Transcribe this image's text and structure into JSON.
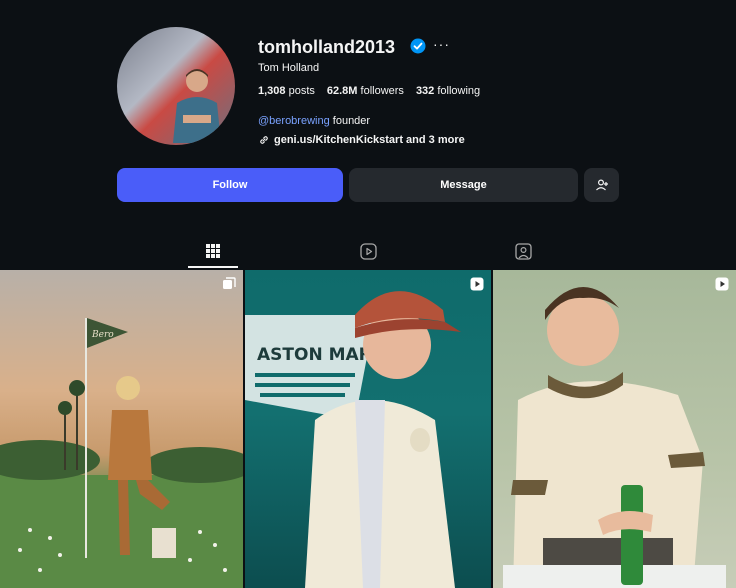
{
  "profile": {
    "username": "tomholland2013",
    "full_name": "Tom Holland",
    "more_label": "···",
    "stats": [
      {
        "count": "1,308",
        "label": "posts"
      },
      {
        "count": "62.8M",
        "label": "followers"
      },
      {
        "count": "332",
        "label": "following"
      }
    ],
    "bio_mention": "@berobrewing",
    "bio_text": " founder",
    "link_text": "geni.us/KitchenKickstart and 3 more"
  },
  "actions": {
    "follow_label": "Follow",
    "message_label": "Message"
  },
  "tabs": [
    {
      "name": "posts",
      "icon": "grid-icon",
      "active": true
    },
    {
      "name": "reels",
      "icon": "reels-icon",
      "active": false
    },
    {
      "name": "tagged",
      "icon": "tagged-icon",
      "active": false
    }
  ],
  "posts": [
    {
      "type": "carousel",
      "icon": "carousel-icon",
      "flag_text": "Bero"
    },
    {
      "type": "reel",
      "icon": "reel-icon",
      "sign_text": "ASTON MARTIN"
    },
    {
      "type": "reel",
      "icon": "reel-icon"
    }
  ],
  "colors": {
    "background": "#0c1014",
    "follow_button": "#4a5df9",
    "secondary_button": "#25292e",
    "mention": "#7aa2ff",
    "verified": "#0095f6"
  }
}
